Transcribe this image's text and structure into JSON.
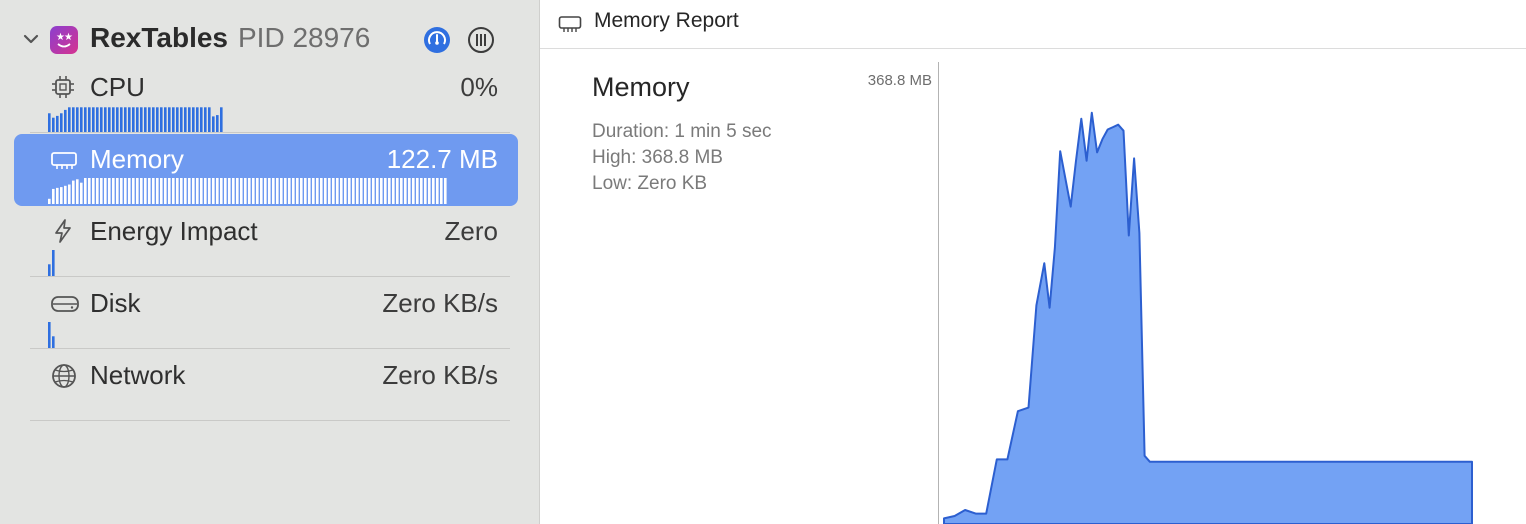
{
  "process": {
    "name": "RexTables",
    "pid_label": "PID 28976"
  },
  "gauges": [
    {
      "name": "cpu",
      "label": "CPU",
      "value": "0%",
      "icon": "cpu-chip-icon",
      "selected": false,
      "spark": [
        0.72,
        0.55,
        0.62,
        0.72,
        0.85,
        0.95,
        0.95,
        0.95,
        0.95,
        0.95,
        0.95,
        0.95,
        0.95,
        0.95,
        0.95,
        0.95,
        0.95,
        0.95,
        0.95,
        0.95,
        0.95,
        0.95,
        0.95,
        0.95,
        0.95,
        0.95,
        0.95,
        0.95,
        0.95,
        0.95,
        0.95,
        0.95,
        0.95,
        0.95,
        0.95,
        0.95,
        0.95,
        0.95,
        0.95,
        0.95,
        0.95,
        0.6,
        0.65,
        0.95
      ]
    },
    {
      "name": "memory",
      "label": "Memory",
      "value": "122.7 MB",
      "icon": "memory-chip-icon",
      "selected": true,
      "spark": [
        0.2,
        0.58,
        0.62,
        0.65,
        0.7,
        0.75,
        0.9,
        0.95,
        0.82,
        1,
        1,
        1,
        1,
        1,
        1,
        1,
        1,
        1,
        1,
        1,
        1,
        1,
        1,
        1,
        1,
        1,
        1,
        1,
        1,
        1,
        1,
        1,
        1,
        1,
        1,
        1,
        1,
        1,
        1,
        1,
        1,
        1,
        1,
        1,
        1,
        1,
        1,
        1,
        1,
        1,
        1,
        1,
        1,
        1,
        1,
        1,
        1,
        1,
        1,
        1,
        1,
        1,
        1,
        1,
        1,
        1,
        1,
        1,
        1,
        1,
        1,
        1,
        1,
        1,
        1,
        1,
        1,
        1,
        1,
        1,
        1,
        1,
        1,
        1,
        1,
        1,
        1,
        1,
        1,
        1,
        1,
        1,
        1,
        1,
        1,
        1,
        1,
        1,
        1,
        1
      ]
    },
    {
      "name": "energy",
      "label": "Energy Impact",
      "value": "Zero",
      "icon": "lightning-bolt-icon",
      "selected": false,
      "spark": [
        0.45,
        1
      ]
    },
    {
      "name": "disk",
      "label": "Disk",
      "value": "Zero KB/s",
      "icon": "hard-drive-icon",
      "selected": false,
      "spark": [
        1,
        0.45
      ]
    },
    {
      "name": "network",
      "label": "Network",
      "value": "Zero KB/s",
      "icon": "globe-icon",
      "selected": false,
      "spark": []
    }
  ],
  "report": {
    "header_title": "Memory Report",
    "title": "Memory",
    "duration": "Duration: 1 min 5 sec",
    "high": "High: 368.8 MB",
    "low": "Low: Zero KB",
    "y_max_label": "368.8 MB"
  },
  "colors": {
    "accent": "#2f6fe0",
    "selection": "#6f9af0",
    "chart_fill": "#73a2f4",
    "chart_line": "#2c5fd0"
  },
  "chart_data": {
    "type": "area",
    "title": "Memory",
    "ylim": [
      0,
      368.8
    ],
    "grid": false,
    "unit": "MB",
    "series": [
      {
        "x": [
          0,
          2,
          4,
          6,
          8,
          10,
          12,
          14,
          16,
          17.5,
          19,
          20,
          21,
          22,
          24,
          25,
          26,
          27,
          28,
          29,
          30,
          31,
          32,
          33,
          34,
          35,
          36,
          37,
          38,
          39,
          40,
          41,
          42,
          43,
          44,
          45,
          46,
          100
        ],
        "y": [
          3,
          5,
          10,
          7,
          7,
          52,
          52,
          92,
          95,
          180,
          215,
          178,
          228,
          308,
          262,
          300,
          335,
          300,
          340,
          307,
          318,
          326,
          328,
          330,
          325,
          238,
          302,
          240,
          55,
          50,
          50,
          50,
          50,
          50,
          50,
          50,
          50,
          50
        ]
      }
    ]
  }
}
